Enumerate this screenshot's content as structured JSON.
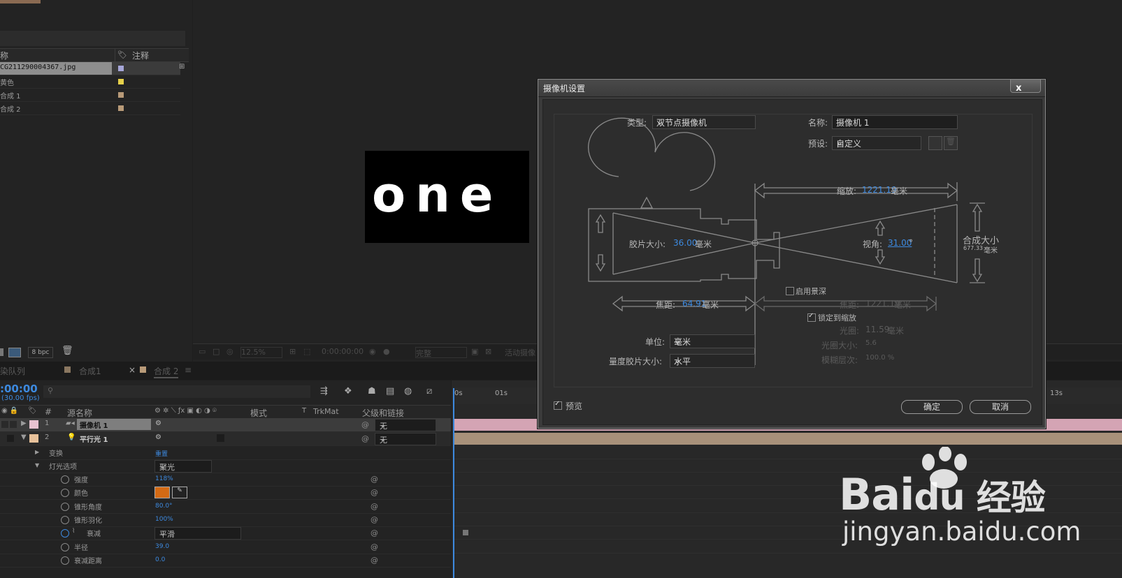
{
  "project": {
    "header_name": "称",
    "header_comment": "注释",
    "items": [
      {
        "name": "CG211290004367.jpg",
        "color": "#a6a6d8"
      },
      {
        "name": "黄色",
        "color": "#e6d04a"
      },
      {
        "name": "合成 1",
        "color": "#b89a78"
      },
      {
        "name": "合成 2",
        "color": "#b89a78"
      }
    ],
    "bpc": "8 bpc"
  },
  "viewer": {
    "canvas_text": "one",
    "zoom": "12.5%",
    "timecode": "0:00:00:00",
    "quality": "完整",
    "camera": "活动摄像"
  },
  "tabs": {
    "render_queue": "染队列",
    "comp1": "合成1",
    "comp2": "合成 2",
    "close": "×",
    "menu": "≡"
  },
  "timeline": {
    "time": ":00:00",
    "fps": "(30.00 fps)",
    "headers": {
      "num": "#",
      "source": "源名称",
      "mode": "模式",
      "t": "T",
      "trkmat": "TrkMat",
      "parent": "父级和链接"
    },
    "layers": [
      {
        "num": "1",
        "name": "摄像机 1",
        "parent": "无"
      },
      {
        "num": "2",
        "name": "平行光 1",
        "parent": "无"
      }
    ],
    "transform_label": "变换",
    "transform_value": "重置",
    "light_options_label": "灯光选项",
    "light_type": "聚光",
    "props": [
      {
        "label": "强度",
        "value": "118%"
      },
      {
        "label": "颜色",
        "value": ""
      },
      {
        "label": "锥形角度",
        "value": "80.0°"
      },
      {
        "label": "锥形羽化",
        "value": "100%"
      },
      {
        "label": "衰减",
        "value": "平滑"
      },
      {
        "label": "半径",
        "value": "39.0"
      },
      {
        "label": "衰减距离",
        "value": "0.0"
      }
    ],
    "light_color": "#d46a14",
    "ruler": [
      "0s",
      "01s",
      "13s"
    ]
  },
  "dialog": {
    "title": "摄像机设置",
    "close": "x",
    "type_label": "类型:",
    "type_value": "双节点摄像机",
    "name_label": "名称:",
    "name_value": "摄像机 1",
    "preset_label": "预设:",
    "preset_value": "自定义",
    "zoom_label": "缩放:",
    "zoom_value": "1221.19",
    "zoom_unit": "毫米",
    "film_label": "胶片大小:",
    "film_value": "36.00",
    "film_unit": "毫米",
    "angle_label": "视角:",
    "angle_value": "31.00",
    "angle_unit": "°",
    "comp_size_label": "合成大小",
    "comp_size_value": "677.33",
    "comp_size_unit": "毫米",
    "dof_label": "启用景深",
    "focal_label": "焦距:",
    "focal_value": "64.91",
    "focal_unit": "毫米",
    "focus_dist_label": "焦距:",
    "focus_dist_value": "1221.19",
    "focus_dist_unit": "毫米",
    "lock_label": "锁定到缩放",
    "aperture_label": "光圈:",
    "aperture_value": "11.59",
    "aperture_unit": "毫米",
    "fstop_label": "光圈大小:",
    "fstop_value": "5.6",
    "blur_label": "模糊层次:",
    "blur_value": "100.0 %",
    "units_label": "单位:",
    "units_value": "毫米",
    "measure_label": "量度胶片大小:",
    "measure_value": "水平",
    "preview_label": "预览",
    "ok": "确定",
    "cancel": "取消"
  },
  "watermark": {
    "brand": "Bai",
    "brand_cn": "经验",
    "url": "jingyan.baidu.com"
  }
}
